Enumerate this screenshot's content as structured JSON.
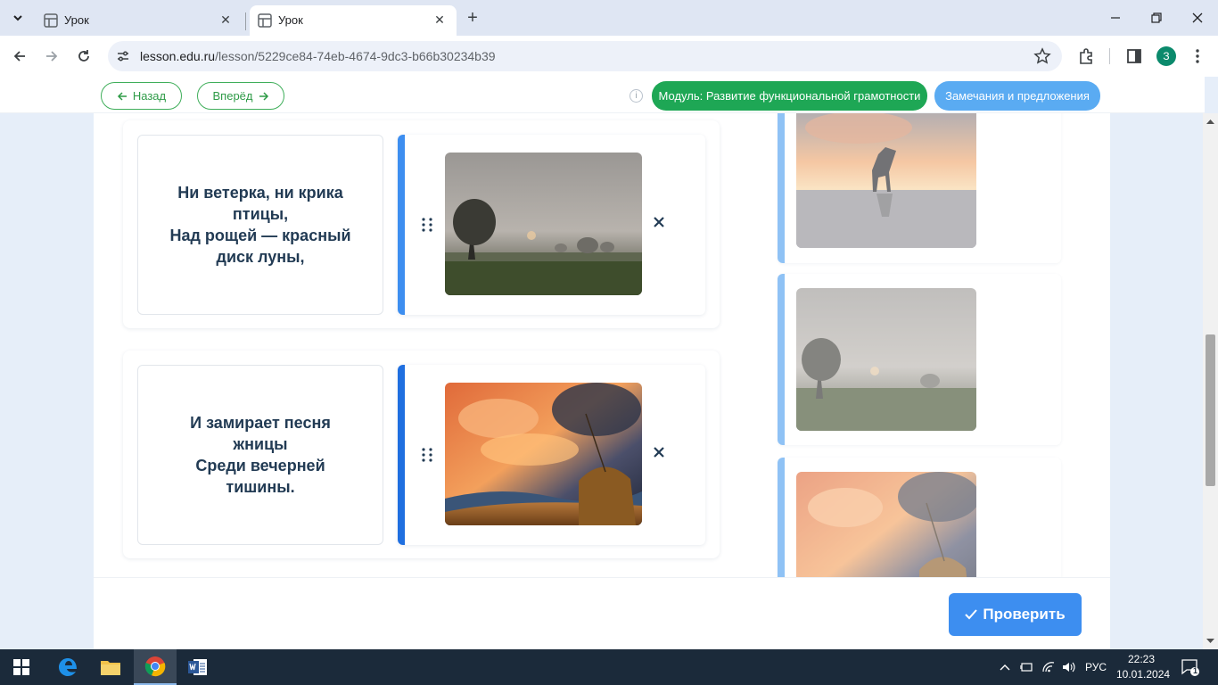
{
  "browser": {
    "tabs": [
      {
        "title": "Урок",
        "active": false
      },
      {
        "title": "Урок",
        "active": true
      }
    ],
    "url_host": "lesson.edu.ru",
    "url_path": "/lesson/5229ce84-74eb-4674-9dc3-b66b30234b39",
    "profile_initial": "З"
  },
  "header": {
    "back_label": "Назад",
    "forward_label": "Вперёд",
    "info_glyph": "i",
    "module_label": "Модуль: Развитие функциональной грамотности",
    "remarks_label": "Замечания и предложения"
  },
  "rows": [
    {
      "text": "Ни ветерка, ни крика\nптицы,\nНад рощей — красный\nдиск луны,",
      "image": "misty-field-tree-sunrise"
    },
    {
      "text": "И замирает песня\nжницы\nСреди вечерней\nтишины.",
      "image": "haystack-sunset-sky"
    }
  ],
  "bank": [
    {
      "image": "horse-silhouette-sunset-beach"
    },
    {
      "image": "misty-field-tree-sunrise"
    },
    {
      "image": "haystack-sunset-sky"
    }
  ],
  "footer": {
    "check_label": "Проверить"
  },
  "taskbar": {
    "language": "РУС",
    "time": "22:23",
    "date": "10.01.2024",
    "notification_count": "1"
  },
  "colors": {
    "accent_blue": "#3d8ef0",
    "module_green": "#1ea755",
    "remarks_blue": "#5aabf2",
    "text_dark": "#223b54"
  }
}
